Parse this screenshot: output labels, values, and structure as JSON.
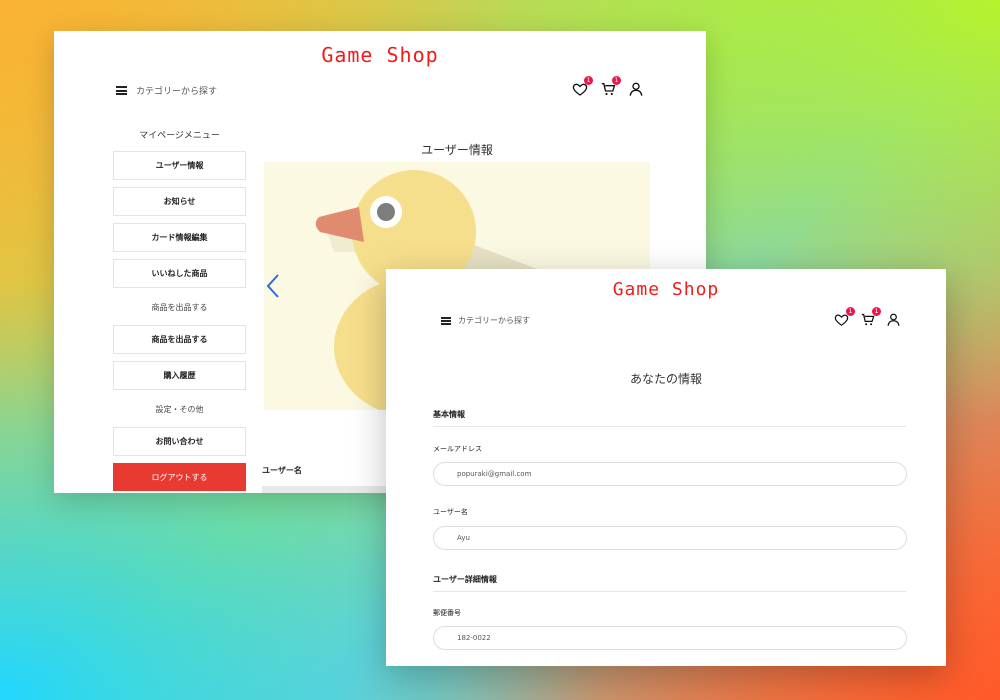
{
  "brand": {
    "name": "Game Shop",
    "color": "#ef1c1c"
  },
  "header": {
    "category_label": "カテゴリーから探す",
    "favorites_count": "1",
    "cart_count": "1",
    "icons": [
      "menu-icon",
      "heart-icon",
      "cart-icon",
      "user-icon"
    ]
  },
  "back_window": {
    "sidebar": {
      "title": "マイページメニュー",
      "items": [
        {
          "label": "ユーザー情報",
          "type": "button"
        },
        {
          "label": "お知らせ",
          "type": "button"
        },
        {
          "label": "カード情報編集",
          "type": "button"
        },
        {
          "label": "いいねした商品",
          "type": "button"
        },
        {
          "label": "商品を出品する",
          "type": "heading"
        },
        {
          "label": "商品を出品する",
          "type": "button"
        },
        {
          "label": "購入履歴",
          "type": "button"
        },
        {
          "label": "設定・その他",
          "type": "heading"
        },
        {
          "label": "お問い合わせ",
          "type": "button"
        }
      ],
      "logout_label": "ログアウトする",
      "logout_color": "#e93a32"
    },
    "main": {
      "title": "ユーザー情報",
      "user_label": "ユーザー名"
    }
  },
  "front_window": {
    "title": "あなたの情報",
    "sections": {
      "basic": "基本情報",
      "detail": "ユーザー詳細情報"
    },
    "fields": {
      "email": {
        "label": "メールアドレス",
        "value": "popuraki@gmail.com"
      },
      "username": {
        "label": "ユーザー名",
        "value": "Ayu"
      },
      "postal": {
        "label": "郵便番号",
        "value": "182-0022"
      }
    }
  }
}
